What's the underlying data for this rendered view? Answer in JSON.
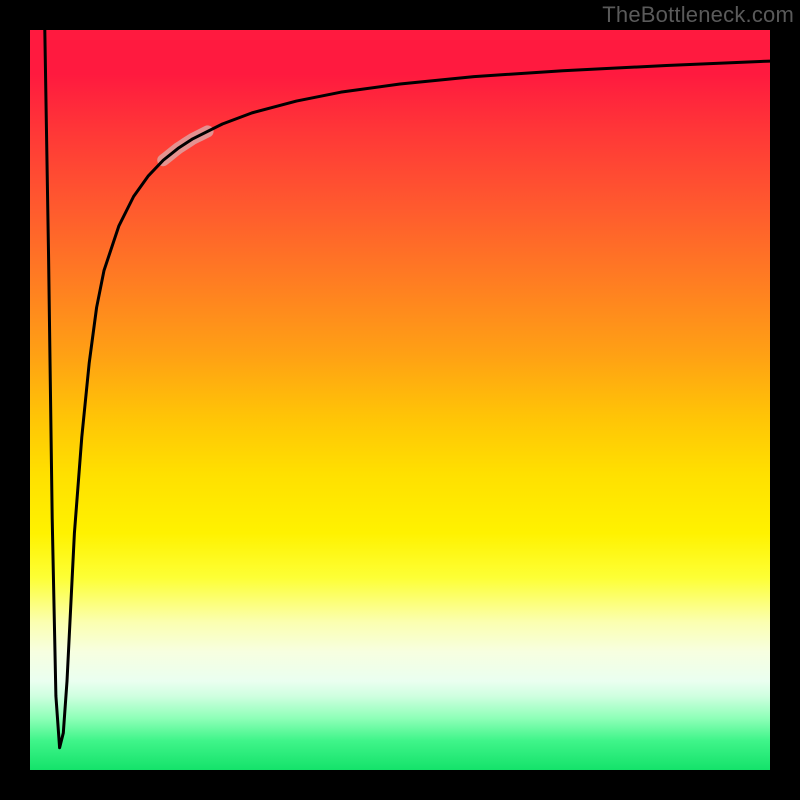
{
  "watermark": "TheBottleneck.com",
  "chart_data": {
    "type": "line",
    "title": "",
    "xlabel": "",
    "ylabel": "",
    "xlim": [
      0,
      100
    ],
    "ylim": [
      0,
      100
    ],
    "grid": false,
    "legend": null,
    "series": [
      {
        "name": "curve",
        "color": "#000000",
        "x": [
          2.0,
          2.5,
          3.0,
          3.5,
          4.0,
          4.5,
          5.0,
          5.5,
          6.0,
          7.0,
          8.0,
          9.0,
          10.0,
          12.0,
          14.0,
          16.0,
          18.0,
          20.0,
          22.0,
          26.0,
          30.0,
          36.0,
          42.0,
          50.0,
          60.0,
          72.0,
          86.0,
          100.0
        ],
        "y": [
          100.0,
          70.0,
          34.0,
          10.0,
          3.0,
          5.0,
          12.0,
          22.0,
          32.0,
          45.0,
          55.0,
          62.5,
          67.5,
          73.5,
          77.5,
          80.3,
          82.4,
          84.0,
          85.3,
          87.3,
          88.8,
          90.4,
          91.6,
          92.7,
          93.7,
          94.5,
          95.2,
          95.8
        ]
      }
    ],
    "annotations": [
      {
        "name": "highlight-segment",
        "x_range": [
          18.0,
          24.0
        ],
        "y_range": [
          82.0,
          86.0
        ],
        "color": "rgba(220,170,170,0.78)"
      }
    ],
    "background_gradient": {
      "direction": "vertical",
      "stops": [
        {
          "pos": 0.0,
          "color": "#ff1a3f"
        },
        {
          "pos": 0.5,
          "color": "#ffd000"
        },
        {
          "pos": 0.8,
          "color": "#fbffb0"
        },
        {
          "pos": 1.0,
          "color": "#14e26a"
        }
      ]
    }
  }
}
